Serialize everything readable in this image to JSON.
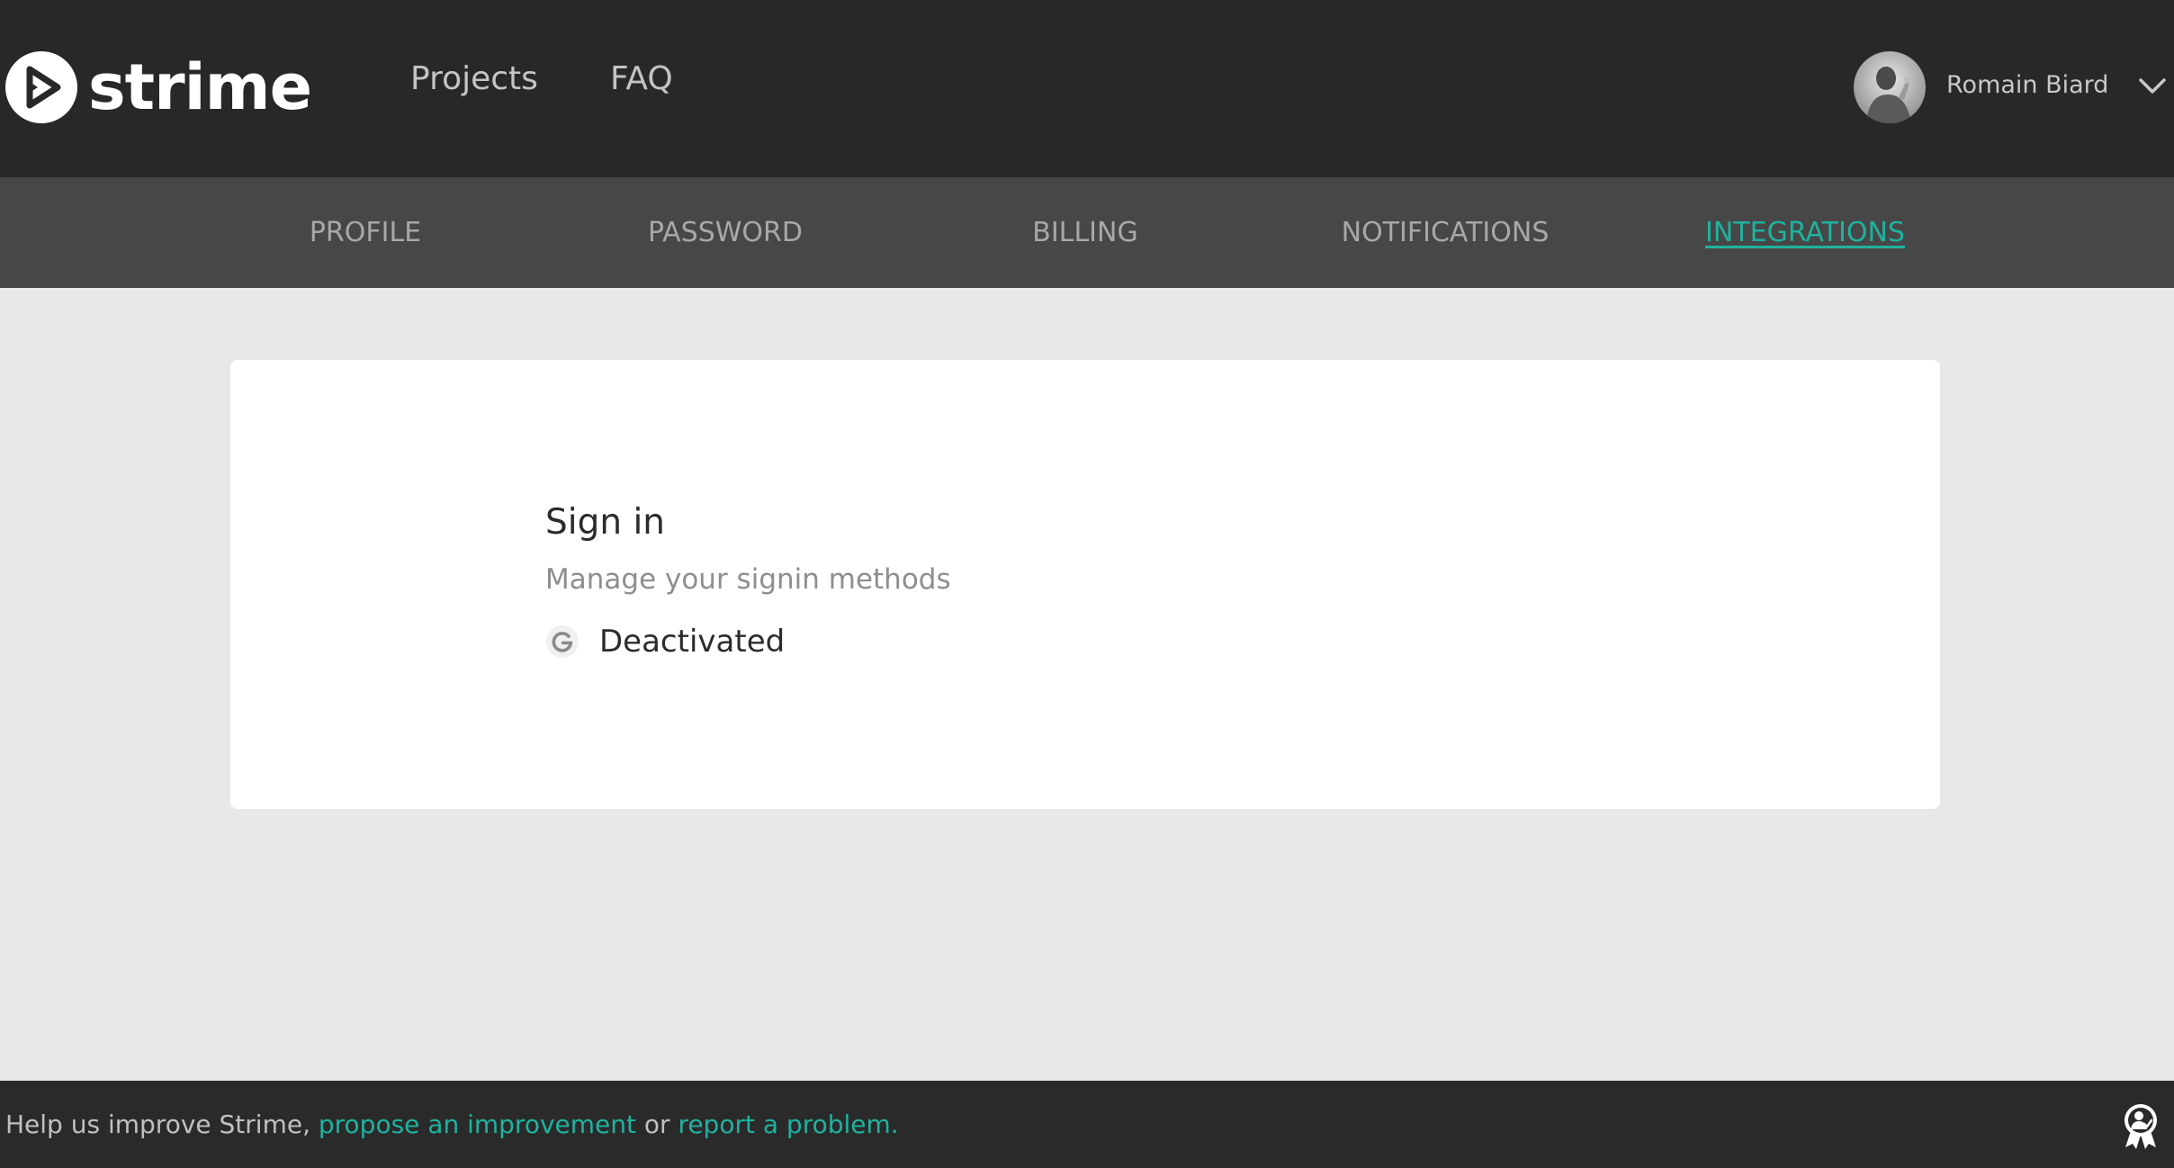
{
  "app": {
    "logo_text": "strime"
  },
  "header": {
    "nav": [
      {
        "label": "Projects"
      },
      {
        "label": "FAQ"
      }
    ],
    "user": {
      "name": "Romain Biard"
    }
  },
  "tabs": [
    {
      "label": "PROFILE",
      "active": false
    },
    {
      "label": "PASSWORD",
      "active": false
    },
    {
      "label": "BILLING",
      "active": false
    },
    {
      "label": "NOTIFICATIONS",
      "active": false
    },
    {
      "label": "INTEGRATIONS",
      "active": true
    }
  ],
  "signin": {
    "title": "Sign in",
    "subtitle": "Manage your signin methods",
    "methods": [
      {
        "provider_icon": "google-icon",
        "status": "Deactivated"
      }
    ]
  },
  "footer": {
    "prefix": "Help us improve Strime, ",
    "improvement_link": "propose an improvement",
    "middle": " or ",
    "problem_link": "report a problem."
  },
  "colors": {
    "accent": "#1fb29f",
    "topbar": "#282828",
    "tabbar": "#474747",
    "background": "#e8e8e8"
  },
  "icons": {
    "logo": "play-logo-icon",
    "chevron": "chevron-down-icon",
    "google": "google-icon",
    "badge": "award-badge-icon"
  }
}
